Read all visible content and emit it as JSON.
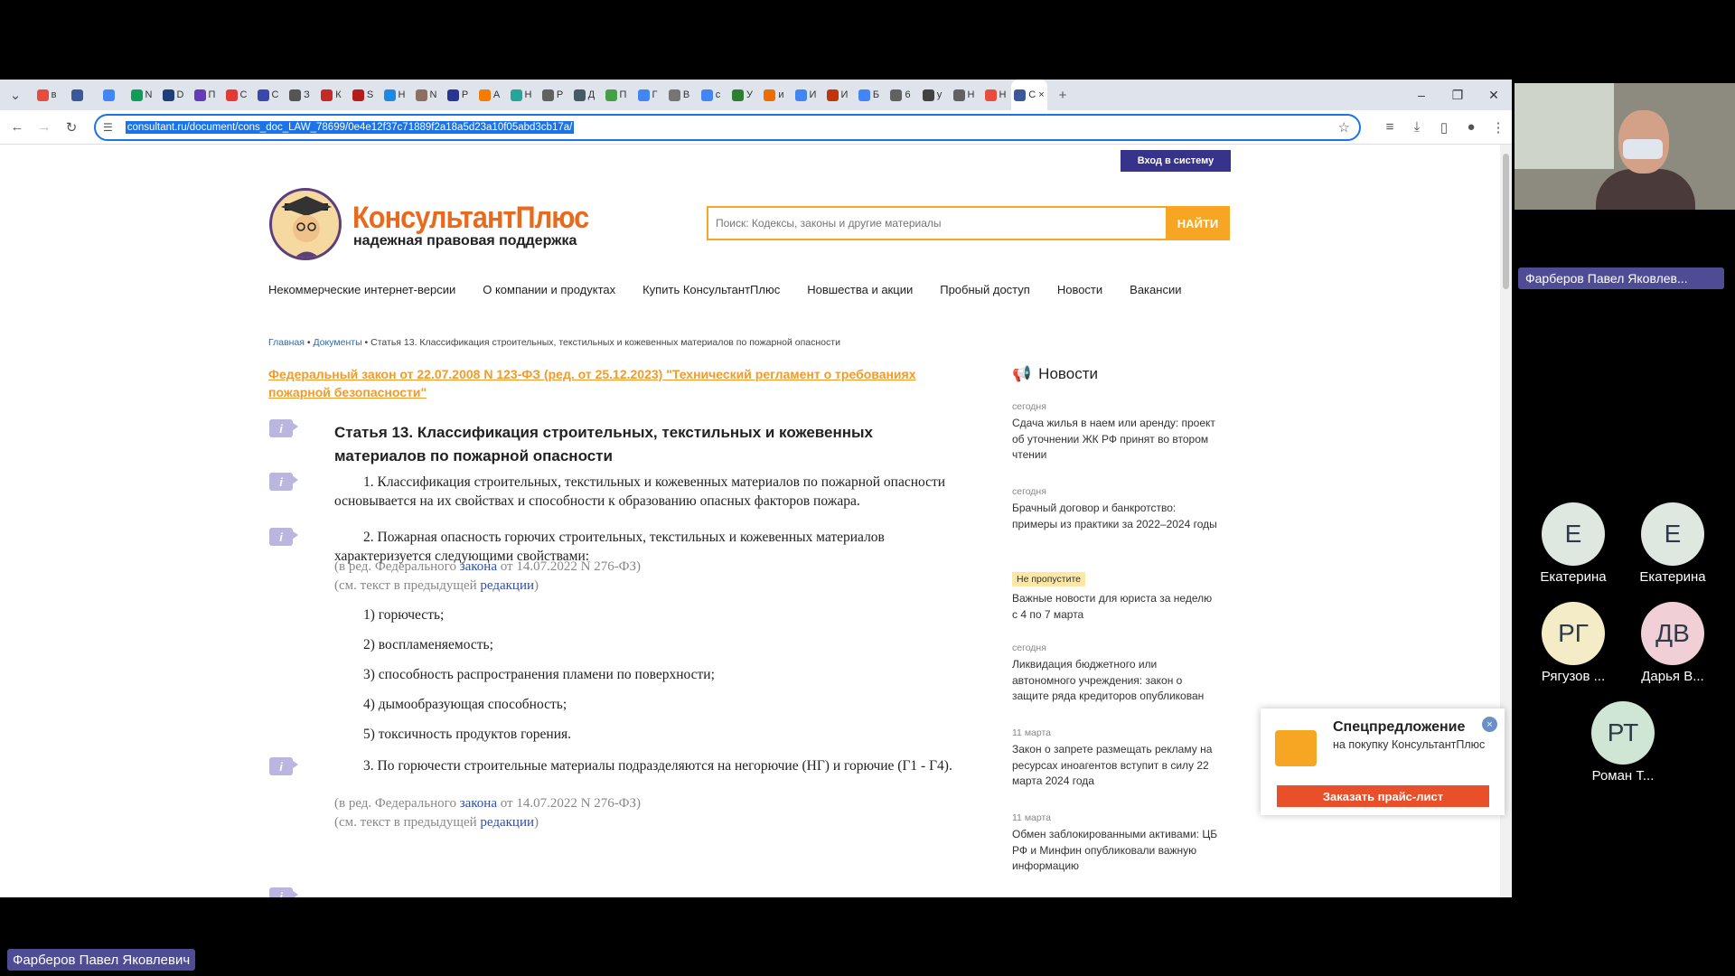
{
  "browser": {
    "tabs": [
      "в",
      "",
      "",
      "N",
      "D",
      "П",
      "C",
      "С",
      "З",
      "К",
      "S",
      "Н",
      "N",
      "P",
      "A",
      "Н",
      "Р",
      "Д",
      "П",
      "Г",
      "В",
      "с",
      "У",
      "и",
      "И",
      "И",
      "Б",
      "6",
      "у",
      "Н",
      "Н",
      "С"
    ],
    "url": "consultant.ru/document/cons_doc_LAW_78699/0e4e12f37c71889f2a18a5d23a10f05abd3cb17a/",
    "new_tab": "+",
    "close_tab": "×",
    "minimize": "–",
    "restore": "❐",
    "close": "✕"
  },
  "site": {
    "login": "Вход в систему",
    "logo_title": "КонсультантПлюс",
    "logo_sub": "надежная правовая поддержка",
    "search_placeholder": "Поиск: Кодексы, законы и другие материалы",
    "search_button": "НАЙТИ",
    "nav": [
      "Некоммерческие интернет-версии",
      "О компании и продуктах",
      "Купить КонсультантПлюс",
      "Новшества и акции",
      "Пробный доступ",
      "Новости",
      "Вакансии"
    ],
    "breadcrumb": {
      "home": "Главная",
      "sep": " • ",
      "docs": "Документы",
      "current": "Статья 13. Классификация строительных, текстильных и кожевенных материалов по пожарной опасности"
    },
    "doc_link": "Федеральный закон от 22.07.2008 N 123-ФЗ (ред. от 25.12.2023) \"Технический регламент о требованиях пожарной безопасности\"",
    "article_title": "Статья 13. Классификация строительных, текстильных и кожевенных материалов по пожарной опасности",
    "p1": "1. Классификация строительных, текстильных и кожевенных материалов по пожарной опасности основывается на их свойствах и способности к образованию опасных факторов пожара.",
    "p2": "2. Пожарная опасность горючих строительных, текстильных и кожевенных материалов характеризуется следующими свойствами:",
    "ed_prefix": "(в ред. Федерального ",
    "ed_link": "закона",
    "ed_suffix": " от 14.07.2022 N 276-ФЗ)",
    "prev_prefix": "(см. текст в предыдущей ",
    "prev_link": "редакции",
    "prev_suffix": ")",
    "items": [
      "1) горючесть;",
      "2) воспламеняемость;",
      "3) способность распространения пламени по поверхности;",
      "4) дымообразующая способность;",
      "5) токсичность продуктов горения."
    ],
    "p3": "3. По горючести строительные материалы подразделяются на негорючие (НГ) и горючие (Г1 - Г4).",
    "badge_i": "i"
  },
  "news": {
    "heading": "Новости",
    "items": [
      {
        "date": "сегодня",
        "text": "Сдача жилья в наем или аренду: проект об уточнении ЖК РФ принят во втором чтении"
      },
      {
        "date": "сегодня",
        "text": "Брачный договор и банкротство: примеры из практики за 2022–2024 годы"
      },
      {
        "date": "Не пропустите",
        "text": "Важные новости для юриста за неделю с 4 по 7 марта"
      },
      {
        "date": "сегодня",
        "text": "Ликвидация бюджетного или автономного учреждения: закон о защите ряда кредиторов опубликован"
      },
      {
        "date": "11 марта",
        "text": "Закон о запрете размещать рекламу на ресурсах иноагентов вступит в силу 22 марта 2024 года"
      },
      {
        "date": "11 марта",
        "text": "Обмен заблокированными активами: ЦБ РФ и Минфин опубликовали важную информацию"
      }
    ]
  },
  "promo": {
    "title": "Спецпредложение",
    "sub": "на покупку КонсультантПлюс",
    "button": "Заказать прайс-лист",
    "close": "×"
  },
  "meeting": {
    "presenter": "Фарберов Павел Яковлев...",
    "participants": [
      {
        "initials": "Е",
        "name": "Екатерина",
        "color": "#dfe8e0"
      },
      {
        "initials": "Е",
        "name": "Екатерина",
        "color": "#dfe8e0"
      },
      {
        "initials": "РГ",
        "name": "Рягузов ...",
        "color": "#f4ecc6"
      },
      {
        "initials": "ДВ",
        "name": "Дарья В...",
        "color": "#f1cfd6"
      },
      {
        "initials": "РТ",
        "name": "Роман Т...",
        "color": "#cfe6d4"
      }
    ],
    "bottom_label": "Фарберов Павел Яковлевич"
  }
}
